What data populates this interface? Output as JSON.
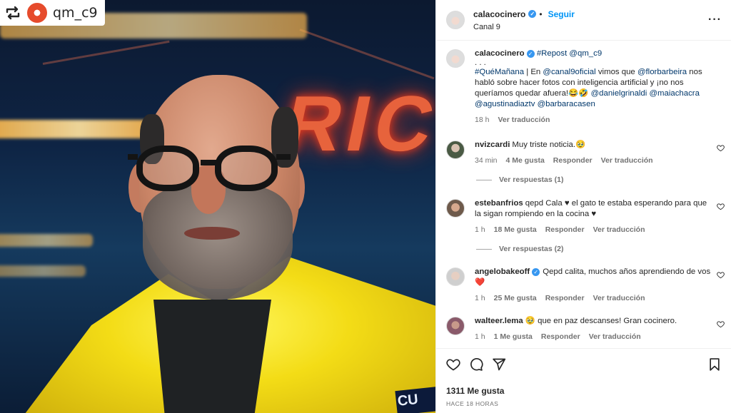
{
  "repost_badge": {
    "username": "qm_c9"
  },
  "header": {
    "username": "calacocinero",
    "follow_label": "Seguir",
    "subtitle": "Canal 9",
    "more_icon": "more-dots-icon"
  },
  "caption": {
    "username": "calacocinero",
    "repost_text": "#Repost @qm_c9",
    "dots": ". . .",
    "hashtag": "#QuéMañana",
    "text_a": " | En ",
    "mention_1": "@canal9oficial",
    "text_b": " vimos que ",
    "mention_2": "@florbarbeira",
    "text_c": " nos habló sobre hacer fotos con inteligencia artificial y ¡no nos queríamos quedar afuera!😂🤣 ",
    "mention_3": "@danielgrinaldi",
    "mention_4": "@maiachacra",
    "mention_5": "@agustinadiaztv",
    "mention_6": "@barbaracasen",
    "time": "18 h",
    "translate": "Ver traducción"
  },
  "comments": [
    {
      "username": "nvizcardi",
      "text": "Muy triste noticia.🥹",
      "time": "34 min",
      "likes": "4 Me gusta",
      "reply": "Responder",
      "translate": "Ver traducción",
      "replies": "Ver respuestas (1)"
    },
    {
      "username": "estebanfrios",
      "text": "qepd Cala ♥ el gato te estaba esperando para que la sigan rompiendo en la cocina ♥",
      "time": "1 h",
      "likes": "18 Me gusta",
      "reply": "Responder",
      "translate": "Ver traducción",
      "replies": "Ver respuestas (2)"
    },
    {
      "username": "angelobakeoff",
      "text": "Qepd calita, muchos años aprendiendo de vos ❤️",
      "time": "1 h",
      "likes": "25 Me gusta",
      "reply": "Responder",
      "translate": "Ver traducción"
    },
    {
      "username": "walteer.lema",
      "text": "🥹 que en paz descanses! Gran cocinero.",
      "time": "1 h",
      "likes": "1 Me gusta",
      "reply": "Responder",
      "translate": "Ver traducción"
    }
  ],
  "actions": {
    "likes": "1311 Me gusta",
    "time_ago": "HACE 18 HORAS"
  },
  "image_text": {
    "neon_sign": "RIC",
    "jacket_logo": "CU"
  },
  "colors": {
    "accent": "#0095f6",
    "link": "#00376b",
    "verified": "#3797f0",
    "jacket": "#f3dc16"
  }
}
